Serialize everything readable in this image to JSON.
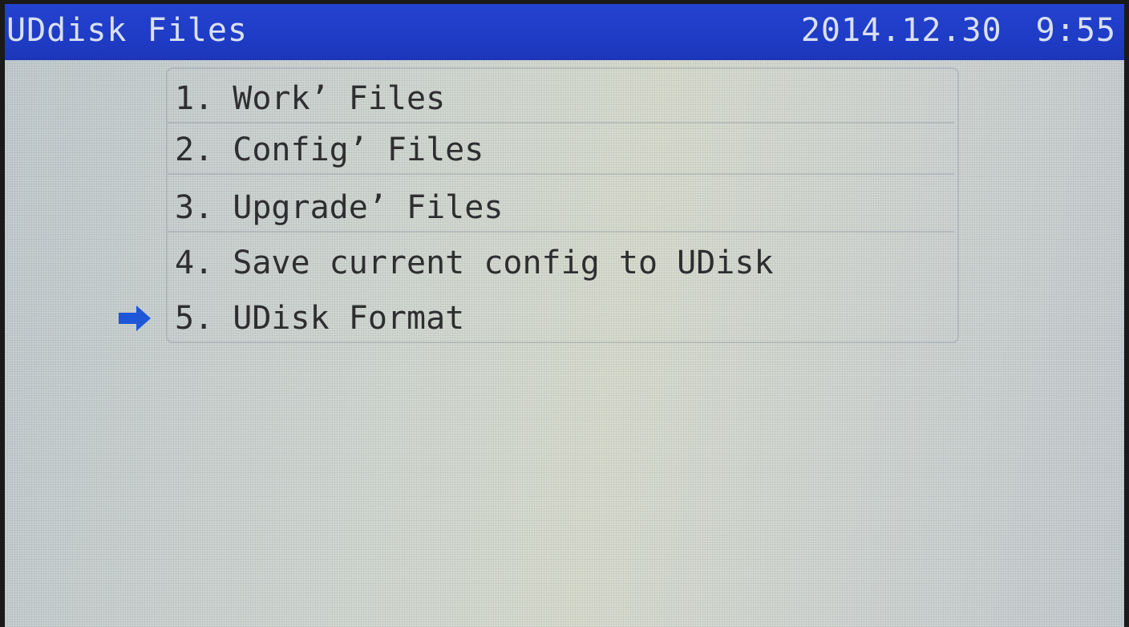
{
  "title_bar": {
    "title": "UDdisk Files",
    "date": "2014.12.30",
    "time": "9:55"
  },
  "menu": {
    "items": [
      {
        "label": "1. Work’ Files"
      },
      {
        "label": "2. Config’ Files"
      },
      {
        "label": "3. Upgrade’ Files"
      },
      {
        "label": "4. Save current config to UDisk"
      },
      {
        "label": "5. UDisk Format"
      }
    ],
    "selected_index": 4,
    "selector_icon": "arrow-right-icon"
  },
  "colors": {
    "title_bar": "#1f3cc6",
    "title_text": "#d9e0f2",
    "screen_bg": "#d2d8d3",
    "menu_text": "#2e2e30",
    "selector_arrow": "#1e56d8"
  }
}
